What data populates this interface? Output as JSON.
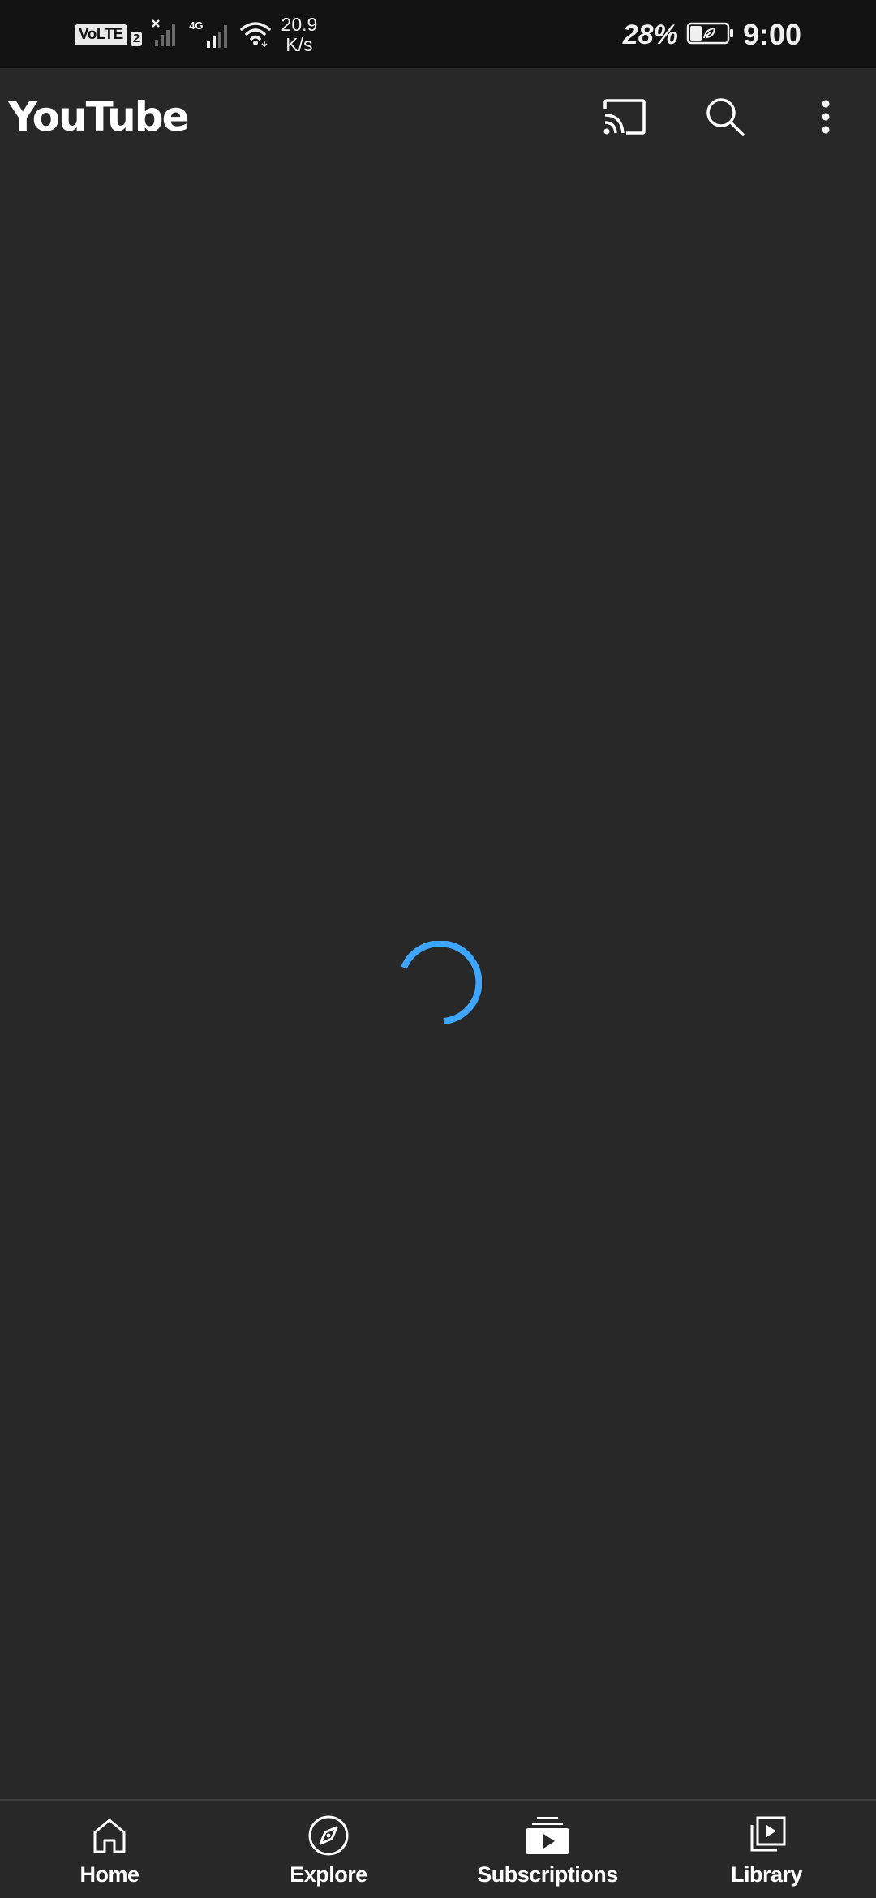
{
  "status_bar": {
    "volte_label": "VoLTE",
    "sim_slot": "2",
    "network_type": "4G",
    "net_speed_value": "20.9",
    "net_speed_unit": "K/s",
    "battery_percent": "28%",
    "time": "9:00",
    "icons": [
      "signal-no-service-icon",
      "signal-4g-icon",
      "wifi-icon",
      "battery-saver-icon"
    ]
  },
  "app_bar": {
    "title": "YouTube",
    "actions": [
      "cast-icon",
      "search-icon",
      "more-vertical-icon"
    ]
  },
  "content": {
    "state": "loading",
    "spinner_color": "#3ea6ff"
  },
  "bottom_nav": {
    "items": [
      {
        "label": "Home",
        "icon": "home-icon"
      },
      {
        "label": "Explore",
        "icon": "explore-compass-icon"
      },
      {
        "label": "Subscriptions",
        "icon": "subscriptions-icon"
      },
      {
        "label": "Library",
        "icon": "library-icon"
      }
    ]
  },
  "colors": {
    "background": "#282829",
    "status_bar": "#131314",
    "text": "#ffffff",
    "accent": "#3ea6ff"
  }
}
